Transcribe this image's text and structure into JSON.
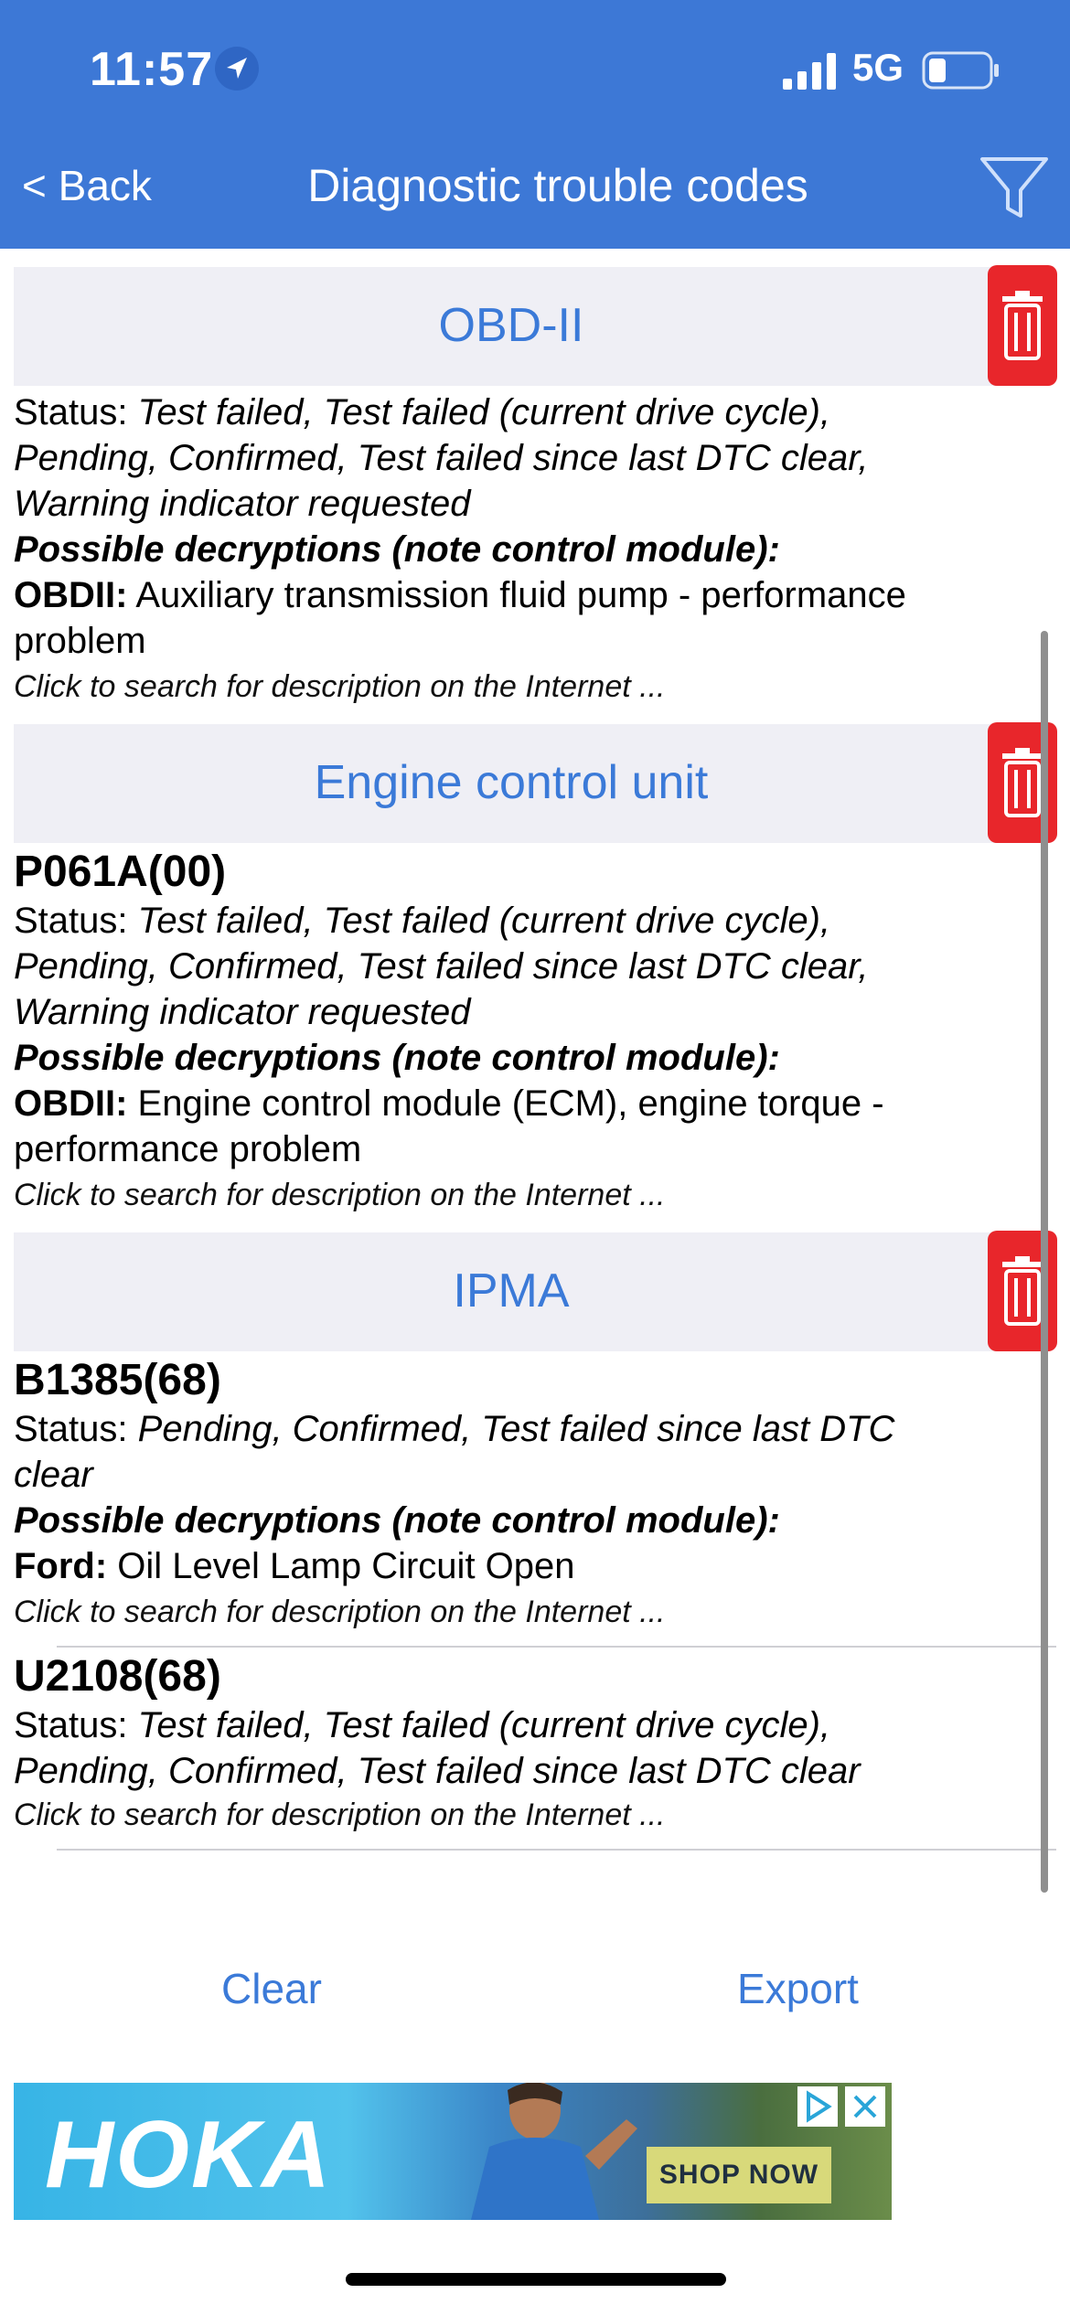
{
  "status_bar": {
    "time": "11:57",
    "network": "5G",
    "icons": [
      "location-arrow-icon",
      "signal-bars-icon",
      "battery-icon"
    ]
  },
  "nav": {
    "back_label": "< Back",
    "title": "Diagnostic trouble codes",
    "filter_icon": "filter-icon"
  },
  "sections": [
    {
      "title": "OBD-II",
      "entries": [
        {
          "status_label": "Status:",
          "status_lines": [
            "Test failed, Test failed (current drive cycle),",
            "Pending, Confirmed, Test failed since last DTC clear,",
            "Warning indicator requested"
          ],
          "decryptions_label": "Possible decryptions (note control module):",
          "decryption_source": "OBDII:",
          "decryption_lines": [
            " Auxiliary transmission fluid pump - performance",
            "problem"
          ],
          "search_hint": "Click to search for description on the Internet ..."
        }
      ]
    },
    {
      "title": "Engine control unit",
      "entries": [
        {
          "code": "P061A(00)",
          "status_label": "Status:",
          "status_lines": [
            "Test failed, Test failed (current drive cycle),",
            "Pending, Confirmed, Test failed since last DTC clear,",
            "Warning indicator requested"
          ],
          "decryptions_label": "Possible decryptions (note control module):",
          "decryption_source": "OBDII:",
          "decryption_lines": [
            " Engine control module (ECM), engine torque -",
            "performance problem"
          ],
          "search_hint": "Click to search for description on the Internet ..."
        }
      ]
    },
    {
      "title": "IPMA",
      "entries": [
        {
          "code": "B1385(68)",
          "status_label": "Status:",
          "status_lines": [
            "Pending, Confirmed, Test failed since last DTC",
            "clear"
          ],
          "decryptions_label": "Possible decryptions (note control module):",
          "decryption_source": "Ford:",
          "decryption_lines": [
            " Oil Level Lamp Circuit Open"
          ],
          "search_hint": "Click to search for description on the Internet ..."
        },
        {
          "code": "U2108(68)",
          "status_label": "Status:",
          "status_lines": [
            "Test failed, Test failed (current drive cycle),",
            "Pending, Confirmed, Test failed since last DTC clear"
          ],
          "search_hint": "Click to search for description on the Internet ..."
        }
      ]
    }
  ],
  "actions": {
    "clear": "Clear",
    "export": "Export"
  },
  "ad": {
    "brand": "HOKA",
    "cta": "SHOP NOW"
  },
  "colors": {
    "nav_bg": "#3d78d6",
    "accent": "#3b7ad8",
    "delete": "#e8262b",
    "header_bg": "#efeff5"
  }
}
